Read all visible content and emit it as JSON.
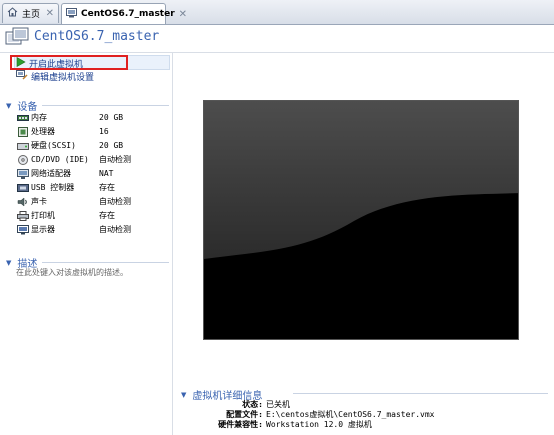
{
  "tabs": [
    {
      "label": "主页",
      "icon": "home-icon"
    },
    {
      "label": "CentOS6.7_master",
      "icon": "vm-icon",
      "active": true
    }
  ],
  "page_title": "CentOS6.7_master",
  "actions": {
    "start": "开启此虚拟机",
    "edit": "编辑虚拟机设置"
  },
  "devices_section": {
    "title": "设备",
    "items": [
      {
        "name": "内存",
        "value": "20 GB",
        "icon": "memory-icon"
      },
      {
        "name": "处理器",
        "value": "16",
        "icon": "cpu-icon"
      },
      {
        "name": "硬盘(SCSI)",
        "value": "20 GB",
        "icon": "harddisk-icon"
      },
      {
        "name": "CD/DVD (IDE)",
        "value": "自动检测",
        "icon": "cd-dvd-icon"
      },
      {
        "name": "网络适配器",
        "value": "NAT",
        "icon": "network-icon"
      },
      {
        "name": "USB 控制器",
        "value": "存在",
        "icon": "usb-icon"
      },
      {
        "name": "声卡",
        "value": "自动检测",
        "icon": "sound-icon"
      },
      {
        "name": "打印机",
        "value": "存在",
        "icon": "printer-icon"
      },
      {
        "name": "显示器",
        "value": "自动检测",
        "icon": "monitor-icon"
      }
    ]
  },
  "description_section": {
    "title": "描述",
    "placeholder": "在此处键入对该虚拟机的描述。"
  },
  "details_section": {
    "title": "虚拟机详细信息",
    "rows": [
      {
        "key": "状态:",
        "value": "已关机"
      },
      {
        "key": "配置文件:",
        "value": "E:\\centos虚拟机\\CentOS6.7_master.vmx"
      },
      {
        "key": "硬件兼容性:",
        "value": "Workstation 12.0 虚拟机"
      }
    ]
  },
  "colors": {
    "accent": "#3a63b0",
    "highlight_border": "#e02020",
    "start_icon": "#2e9e2e"
  }
}
